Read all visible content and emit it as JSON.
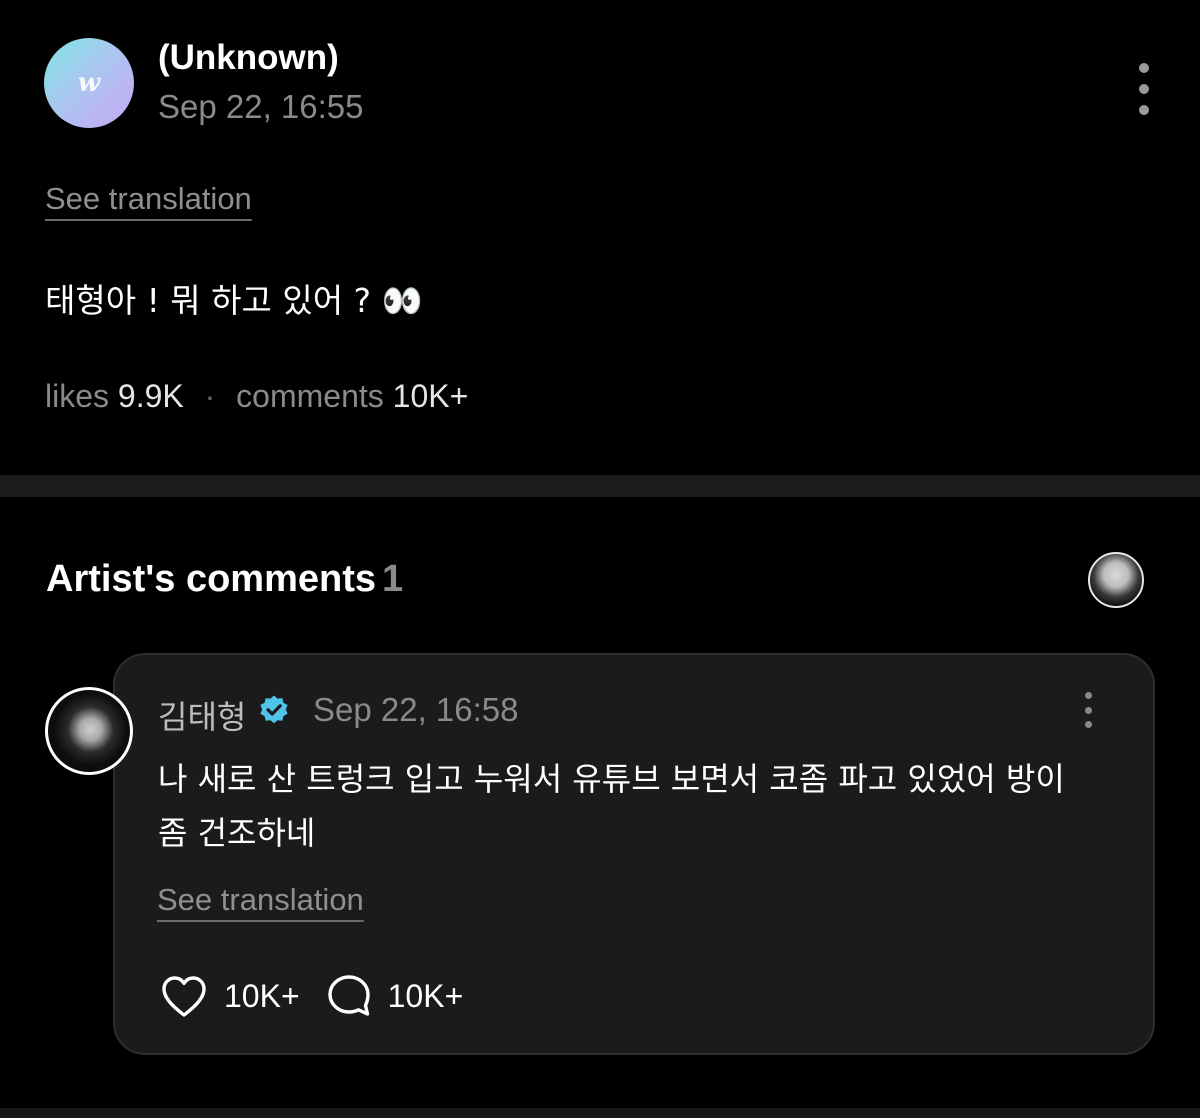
{
  "post": {
    "avatar_letter": "w",
    "author": "(Unknown)",
    "time": "Sep 22, 16:55",
    "see_translation": "See translation",
    "body": "태형아 ! 뭐 하고 있어 ? 👀",
    "likes_label": "likes",
    "likes_count": "9.9K",
    "separator": "·",
    "comments_label": "comments",
    "comments_count": "10K+"
  },
  "artist_comments": {
    "title": "Artist's comments",
    "count": "1",
    "comment": {
      "author": "김태형",
      "verified_icon": "verified-badge-icon",
      "time": "Sep 22, 16:58",
      "text": "나 새로 산 트렁크 입고 누워서 유튜브 보면서 코좀 파고 있었어 방이 좀 건조하네",
      "see_translation": "See translation",
      "like_count": "10K+",
      "reply_count": "10K+"
    }
  },
  "colors": {
    "background": "#000000",
    "card": "#1b1b1b",
    "muted_text": "#8a8a8a",
    "verified": "#4fc3e8"
  }
}
